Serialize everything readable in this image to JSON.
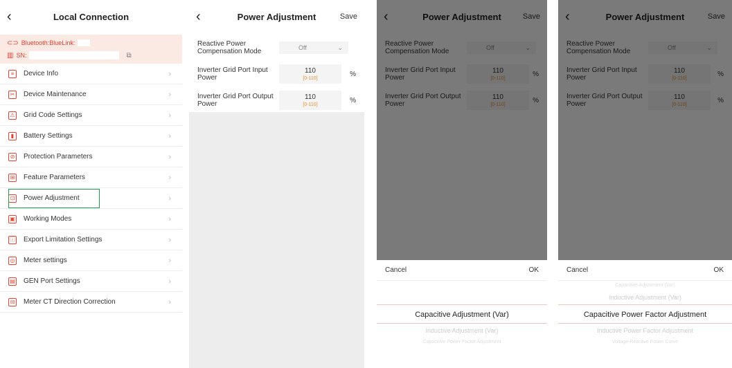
{
  "panel1": {
    "title": "Local Connection",
    "bluetooth_label": "Bluetooth:BlueLink:",
    "sn_label": "SN:",
    "menu": [
      {
        "label": "Device Info",
        "icon": "device-info-icon"
      },
      {
        "label": "Device Maintenance",
        "icon": "maintenance-icon"
      },
      {
        "label": "Grid Code Settings",
        "icon": "grid-code-icon"
      },
      {
        "label": "Battery Settings",
        "icon": "battery-icon"
      },
      {
        "label": "Protection Parameters",
        "icon": "protection-icon"
      },
      {
        "label": "Feature Parameters",
        "icon": "feature-icon"
      },
      {
        "label": "Power Adjustment",
        "icon": "power-adjustment-icon"
      },
      {
        "label": "Working Modes",
        "icon": "working-modes-icon"
      },
      {
        "label": "Export Limitation Settings",
        "icon": "export-limit-icon"
      },
      {
        "label": "Meter settings",
        "icon": "meter-icon"
      },
      {
        "label": "GEN Port Settings",
        "icon": "gen-port-icon"
      },
      {
        "label": "Meter CT Direction Correction",
        "icon": "meter-ct-icon"
      }
    ]
  },
  "power": {
    "title": "Power Adjustment",
    "save": "Save",
    "reactive_label": "Reactive Power Compensation Mode",
    "reactive_value": "Off",
    "input_label": "Inverter Grid Port Input Power",
    "input_value": "110",
    "input_range": "[0-110]",
    "output_label": "Inverter Grid Port Output Power",
    "output_value": "110",
    "output_range": "[0-110]",
    "unit": "%"
  },
  "picker1": {
    "cancel": "Cancel",
    "ok": "OK",
    "selected": "Capacitive Adjustment (Var)",
    "after1": "Inductive Adjustment (Var)",
    "after2": "Capacitive Power Factor Adjustment"
  },
  "picker2": {
    "cancel": "Cancel",
    "ok": "OK",
    "before2": "Capacitive Adjustment (Var)",
    "before1": "Inductive Adjustment (Var)",
    "selected": "Capacitive Power Factor Adjustment",
    "after1": "Inductive Power Factor Adjustment",
    "after2": "Voltage-Reactive Power Curve"
  },
  "colors": {
    "accent": "#e8402f",
    "highlight": "#1b9e4b",
    "range": "#e8902f"
  }
}
